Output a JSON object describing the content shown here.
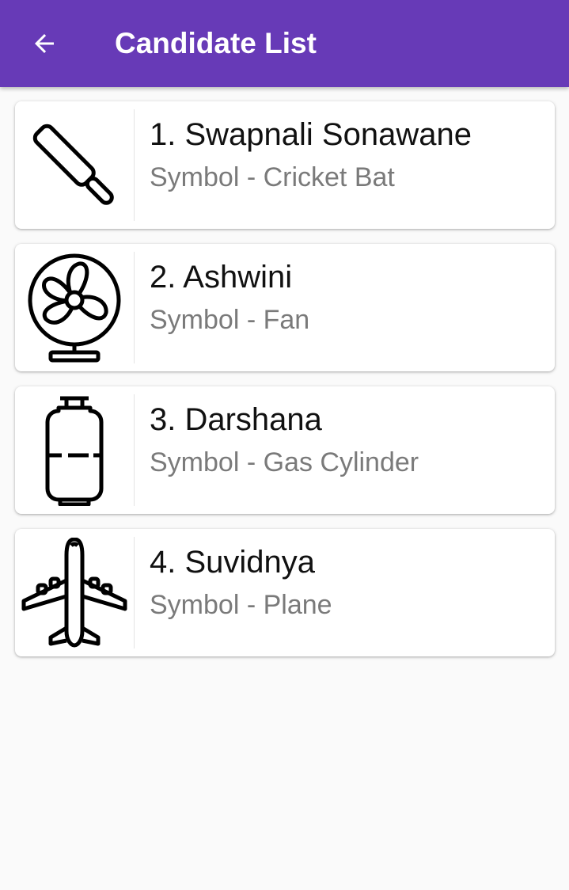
{
  "appbar": {
    "title": "Candidate List",
    "back_icon": "arrow-back-icon",
    "color": "#673ab7"
  },
  "candidates": [
    {
      "name": "1. Swapnali Sonawane",
      "symbol": "Symbol - Cricket Bat",
      "icon": "cricket-bat-icon"
    },
    {
      "name": "2. Ashwini",
      "symbol": "Symbol - Fan",
      "icon": "fan-icon"
    },
    {
      "name": "3. Darshana",
      "symbol": "Symbol - Gas Cylinder",
      "icon": "gas-cylinder-icon"
    },
    {
      "name": "4. Suvidnya",
      "symbol": "Symbol - Plane",
      "icon": "plane-icon"
    }
  ]
}
